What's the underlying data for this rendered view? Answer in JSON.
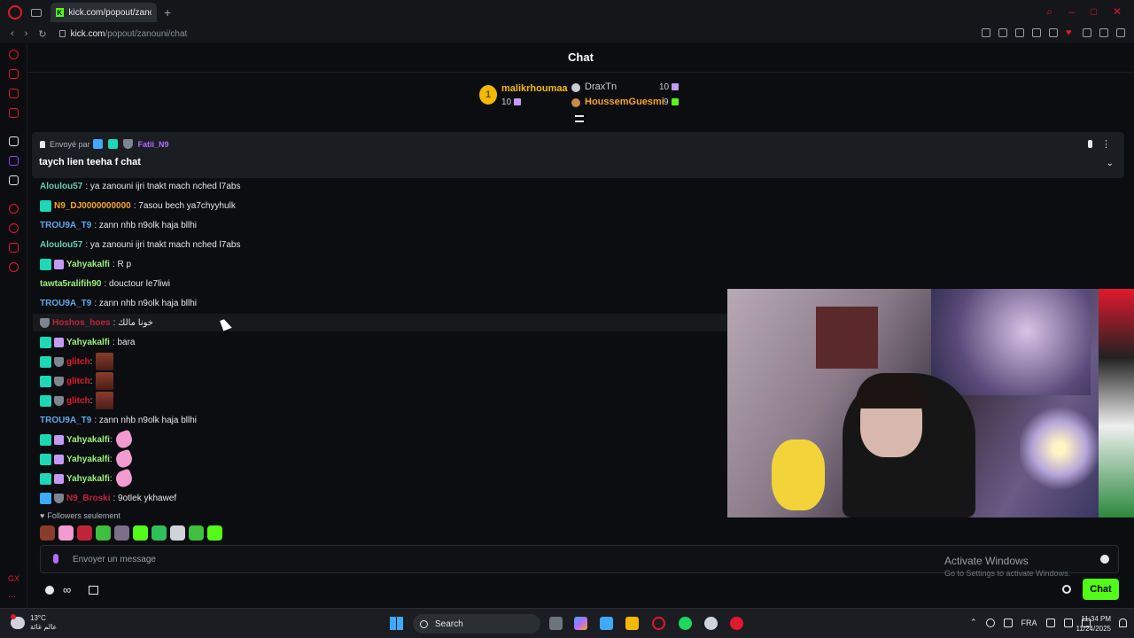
{
  "browser": {
    "tab_title": "kick.com/popout/zanouni",
    "new_tab": "+",
    "url_host": "kick.com",
    "url_path": "/popout/zanouni/chat"
  },
  "chat": {
    "header_title": "Chat",
    "leaderboard": {
      "first": {
        "rank": "1",
        "name": "malikrhoumaa",
        "count": "10"
      },
      "second": {
        "name": "DraxTn",
        "count": "10"
      },
      "third": {
        "name": "HoussemGuesmi",
        "count": "9"
      }
    },
    "pinned": {
      "sent_by_label": "Envoyé par",
      "user": "Fatii_N9",
      "message": "taych lien teeha f chat"
    },
    "messages": [
      {
        "user": "Aloulou57",
        "color": "#5fd1b0",
        "text": ": ya zanouni ijri tnakt mach nched l7abs",
        "badges": []
      },
      {
        "user": "N9_DJ0000000000",
        "color": "#f5a623",
        "text": ": 7asou bech ya7chyyhulk",
        "badges": [
          "og"
        ]
      },
      {
        "user": "TROU9A_T9",
        "color": "#5fa8e8",
        "text": ": zann nhb n9olk haja bllhi",
        "badges": []
      },
      {
        "user": "Aloulou57",
        "color": "#5fd1b0",
        "text": ": ya zanouni ijri tnakt mach nched l7abs",
        "badges": []
      },
      {
        "user": "Yahyakalfi",
        "color": "#9ef07a",
        "text": ": R p",
        "badges": [
          "og",
          "sub"
        ]
      },
      {
        "user": "tawta5ralifih90",
        "color": "#9ef07a",
        "text": ": douctour le7liwi",
        "badges": []
      },
      {
        "user": "TROU9A_T9",
        "color": "#5fa8e8",
        "text": ": zann nhb n9olk haja bllhi",
        "badges": []
      },
      {
        "user": "Hoshos_hoes",
        "color": "#c0243a",
        "text": ": خونا مالك",
        "badges": [
          "knight"
        ]
      },
      {
        "user": "Yahyakalfi",
        "color": "#9ef07a",
        "text": ": bara",
        "badges": [
          "og",
          "sub"
        ]
      },
      {
        "user": "glitch",
        "color": "#e2182e",
        "text": ":",
        "badges": [
          "og",
          "knight"
        ]
      },
      {
        "user": "glitch",
        "color": "#e2182e",
        "text": ":",
        "badges": [
          "og",
          "knight"
        ]
      },
      {
        "user": "glitch",
        "color": "#e2182e",
        "text": ":",
        "badges": [
          "og",
          "knight"
        ]
      },
      {
        "user": "TROU9A_T9",
        "color": "#5fa8e8",
        "text": ": zann nhb n9olk haja bllhi",
        "badges": []
      },
      {
        "user": "Yahyakalfi",
        "color": "#9ef07a",
        "text": ":",
        "badges": [
          "og",
          "sub"
        ]
      },
      {
        "user": "Yahyakalfi",
        "color": "#9ef07a",
        "text": ":",
        "badges": [
          "og",
          "sub"
        ]
      },
      {
        "user": "Yahyakalfi",
        "color": "#9ef07a",
        "text": ":",
        "badges": [
          "og",
          "sub"
        ]
      },
      {
        "user": "N9_Broski",
        "color": "#c0243a",
        "text": ": 9otlek ykhawef",
        "badges": [
          "vip",
          "knight"
        ]
      }
    ],
    "followers_only": "Followers seulement",
    "input_placeholder": "Envoyer un message",
    "send_button": "Chat"
  },
  "windows": {
    "activate_title": "Activate Windows",
    "activate_sub": "Go to Settings to activate Windows."
  },
  "taskbar": {
    "temperature": "13°C",
    "weather_desc": "عالم غائة",
    "search": "Search",
    "lang": "FRA",
    "time": "11:34 PM",
    "date": "11/24/2025"
  },
  "colors": {
    "kick_green": "#53fc18",
    "opera_red": "#e2182e",
    "gold": "#f5b800"
  }
}
